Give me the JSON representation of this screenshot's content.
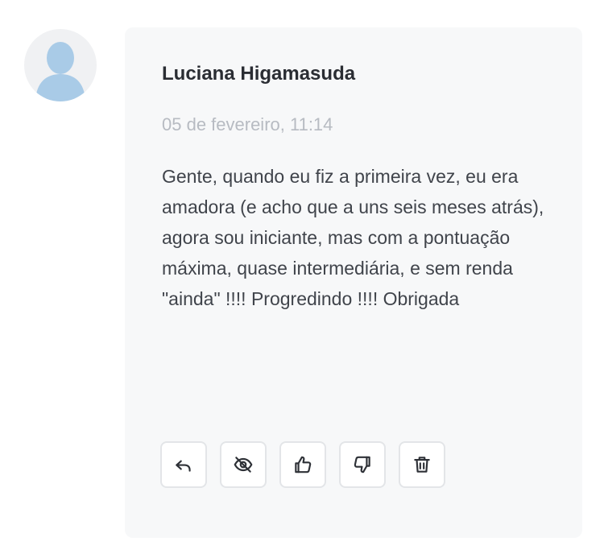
{
  "comment": {
    "author": "Luciana Higamasuda",
    "timestamp": "05 de fevereiro, 11:14",
    "text": "Gente, quando eu fiz a primeira vez, eu era amadora (e acho que a uns seis meses atrás), agora sou iniciante, mas com a pontuação máxima, quase intermediária, e sem renda \"ainda\" !!!! Progredindo !!!! Obrigada"
  },
  "avatar": {
    "icon": "user-silhouette-icon",
    "color": "#a9cbe7"
  },
  "actions": [
    {
      "name": "reply",
      "icon": "reply-icon"
    },
    {
      "name": "hide",
      "icon": "eye-off-icon"
    },
    {
      "name": "like",
      "icon": "thumbs-up-icon"
    },
    {
      "name": "dislike",
      "icon": "thumbs-down-icon"
    },
    {
      "name": "delete",
      "icon": "trash-icon"
    }
  ]
}
